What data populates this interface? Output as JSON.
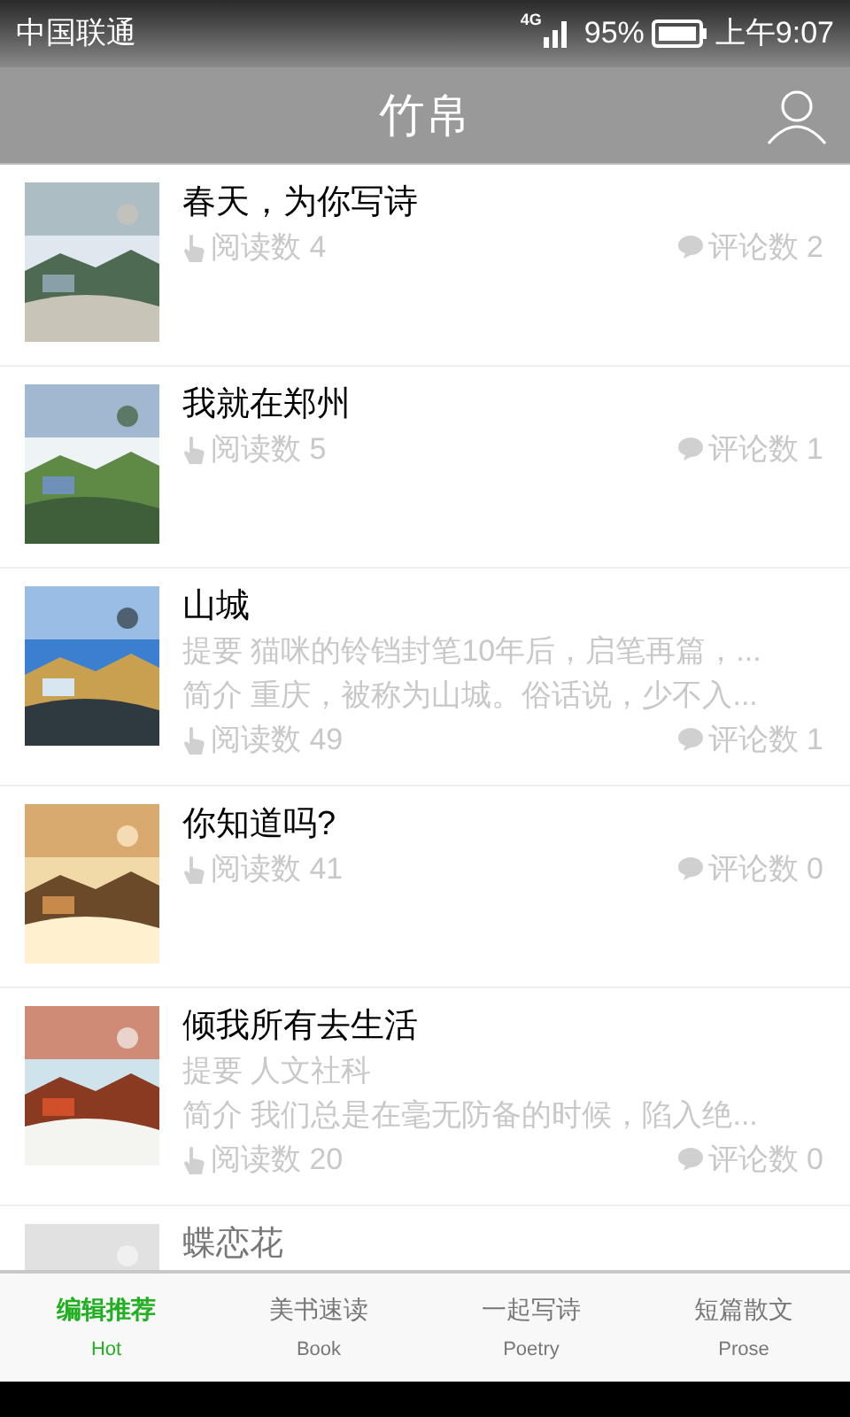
{
  "status_bar": {
    "carrier": "中国联通",
    "network": "4G",
    "battery": "95%",
    "time": "上午9:07"
  },
  "header": {
    "title": "竹帛"
  },
  "articles": [
    {
      "title": "春天，为你写诗",
      "reads": "阅读数 4",
      "comments": "评论数 2"
    },
    {
      "title": "我就在郑州",
      "reads": "阅读数 5",
      "comments": "评论数 1"
    },
    {
      "title": "山城",
      "summary": "提要 猫咪的铃铛封笔10年后，启笔再篇，...",
      "intro": "简介 重庆，被称为山城。俗话说，少不入...",
      "reads": "阅读数 49",
      "comments": "评论数 1"
    },
    {
      "title": "你知道吗?",
      "reads": "阅读数 41",
      "comments": "评论数 0"
    },
    {
      "title": "倾我所有去生活",
      "summary": "提要 人文社科",
      "intro": "简介 我们总是在毫无防备的时候，陷入绝...",
      "reads": "阅读数 20",
      "comments": "评论数 0"
    },
    {
      "title": "蝶恋花"
    }
  ],
  "tabs": [
    {
      "label": "编辑推荐",
      "sublabel": "Hot",
      "selected": true
    },
    {
      "label": "美书速读",
      "sublabel": "Book",
      "selected": false
    },
    {
      "label": "一起写诗",
      "sublabel": "Poetry",
      "selected": false
    },
    {
      "label": "短篇散文",
      "sublabel": "Prose",
      "selected": false
    }
  ]
}
